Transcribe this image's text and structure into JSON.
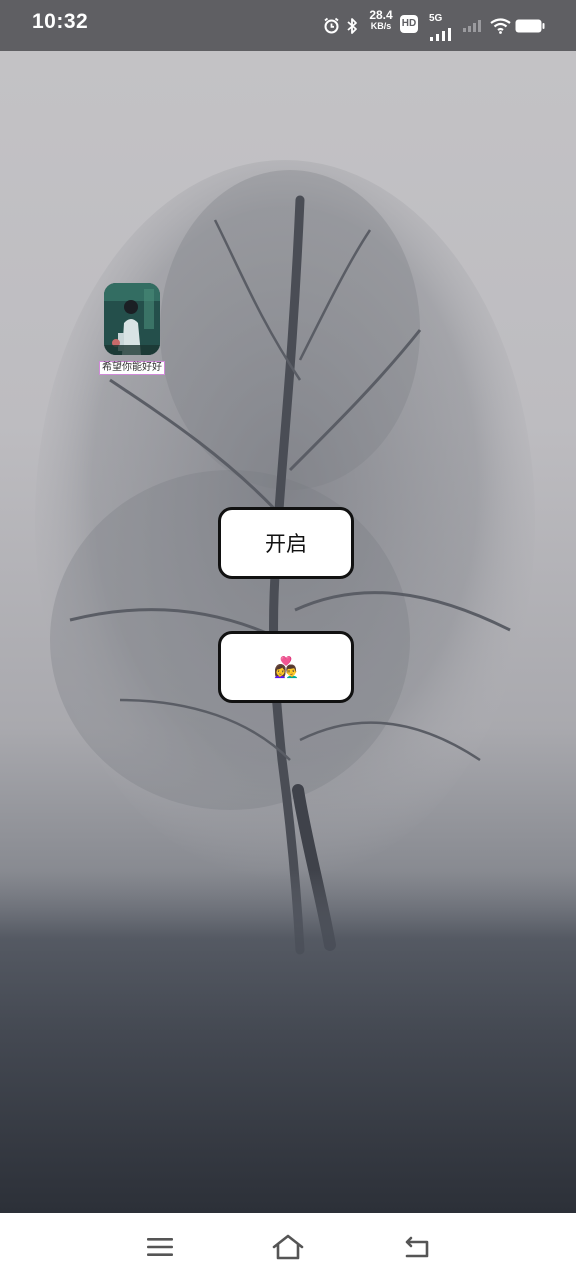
{
  "status_bar": {
    "time": "10:32",
    "net_speed_value": "28.4",
    "net_speed_unit": "KB/s",
    "hd_badge": "HD",
    "network_type": "5G",
    "icons": [
      "alarm-icon",
      "bluetooth-icon",
      "signal-icon",
      "wifi-icon",
      "battery-icon"
    ]
  },
  "desktop": {
    "shortcut_label": "希望你能好好"
  },
  "buttons": {
    "start_label": "开启",
    "couple_label": "👩‍❤️‍👨"
  },
  "nav_bar": {
    "icons": [
      "menu-icon",
      "home-icon",
      "back-icon"
    ]
  },
  "colors": {
    "status_bar_bg": "#5f5f63",
    "button_border": "#111111",
    "button_bg": "#ffffff",
    "label_border": "#d08ad8"
  }
}
